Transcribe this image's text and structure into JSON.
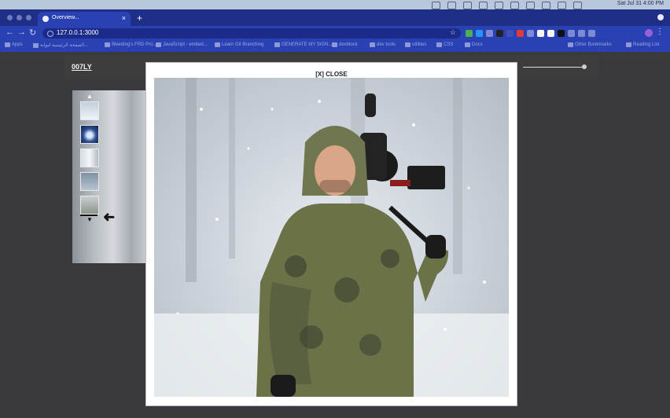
{
  "browser": {
    "clock": "Sat Jul 31 4:00 PM",
    "tab_title": "Overview...",
    "new_tab": "+",
    "close_tab": "×",
    "url": "127.0.0.1:3000",
    "bookmarks": [
      "Apps",
      "الصفحة الرئيسية لبوابة...",
      "Bleeding's FRD Pro...",
      "JavaScript - embed...",
      "Learn Git Branching",
      "GENERATE MY SIGN...",
      "devblock",
      "dev tools",
      "utilities",
      "CSS",
      "Docs",
      "Other Bookmarks",
      "Reading List"
    ]
  },
  "site": {
    "logo": "007LY",
    "close_label": "[X] CLOSE",
    "scroll_up": "▲",
    "scroll_down": "▼",
    "arrow": "➜"
  },
  "icons": {
    "close": "close-icon",
    "arrow": "left-arrow-icon"
  }
}
